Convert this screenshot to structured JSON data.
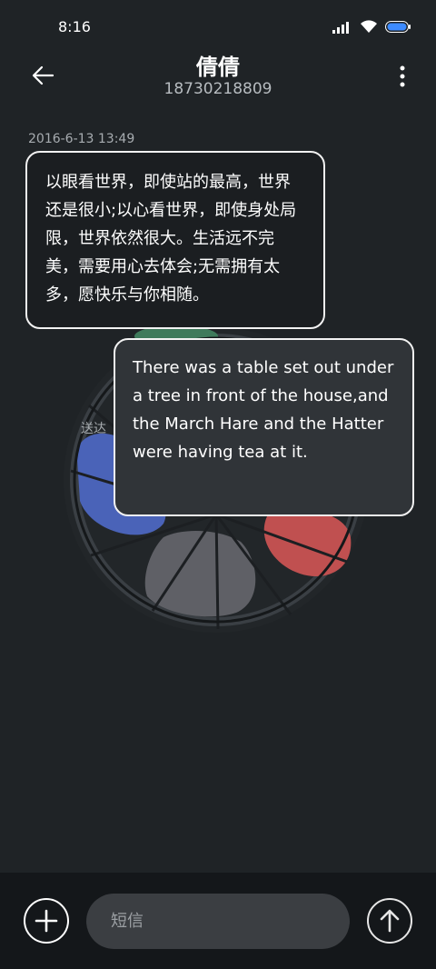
{
  "status_bar": {
    "time": "8:16"
  },
  "header": {
    "contact_name": "倩倩",
    "phone_number": "18730218809"
  },
  "conversation": {
    "timestamp": "2016-6-13 13:49",
    "delivered_label": "送达",
    "messages": [
      {
        "direction": "incoming",
        "text": "以眼看世界，即使站的最高，世界还是很小;以心看世界，即使身处局限，世界依然很大。生活远不完美，需要用心去体会;无需拥有太多，愿快乐与你相随。"
      },
      {
        "direction": "outgoing",
        "text": "There was a table set out under a tree in front of the house,and the March Hare and the Hatter were having tea at it."
      }
    ]
  },
  "composer": {
    "placeholder": "短信"
  },
  "colors": {
    "background": "#1f2326",
    "footer": "#14171a",
    "input": "#3b3e42",
    "art_blue": "#4a63b8",
    "art_red": "#c05050",
    "art_green": "#3f7a5b",
    "art_gray": "#5f6066"
  }
}
